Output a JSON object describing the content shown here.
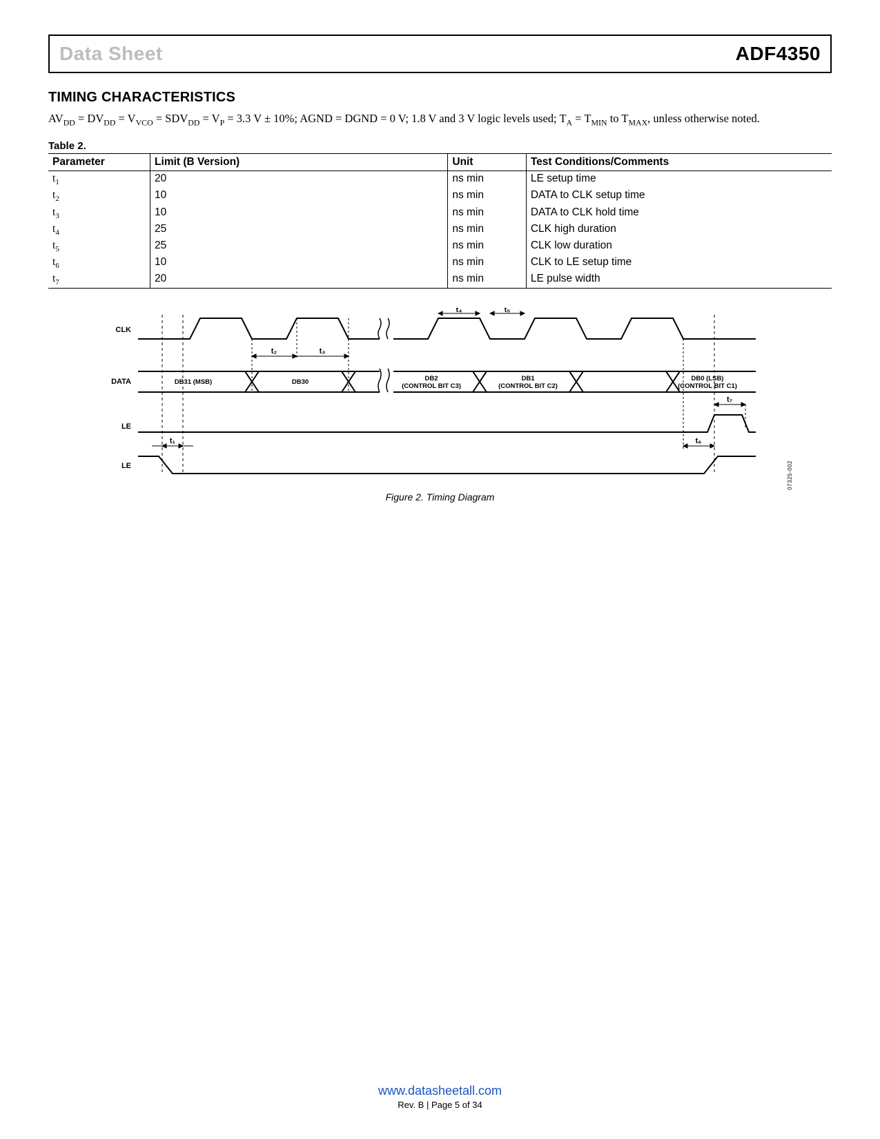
{
  "header": {
    "left": "Data Sheet",
    "right": "ADF4350"
  },
  "section": {
    "title": "TIMING CHARACTERISTICS",
    "conditions_html": "AV<sub>DD</sub> = DV<sub>DD</sub> = V<sub>VCO</sub> = SDV<sub>DD</sub> = V<sub>P</sub> = 3.3 V ± 10%; AGND = DGND = 0 V; 1.8 V and 3 V logic levels used; T<sub>A</sub> = T<sub>MIN</sub> to T<sub>MAX</sub>, unless otherwise noted."
  },
  "table": {
    "caption": "Table 2.",
    "headers": [
      "Parameter",
      "Limit (B Version)",
      "Unit",
      "Test Conditions/Comments"
    ],
    "rows": [
      {
        "param": "t",
        "sub": "1",
        "limit": "20",
        "unit": "ns min",
        "cond": "LE setup time"
      },
      {
        "param": "t",
        "sub": "2",
        "limit": "10",
        "unit": "ns min",
        "cond": "DATA to CLK setup time"
      },
      {
        "param": "t",
        "sub": "3",
        "limit": "10",
        "unit": "ns min",
        "cond": "DATA to CLK hold time"
      },
      {
        "param": "t",
        "sub": "4",
        "limit": "25",
        "unit": "ns min",
        "cond": "CLK high duration"
      },
      {
        "param": "t",
        "sub": "5",
        "limit": "25",
        "unit": "ns min",
        "cond": "CLK low duration"
      },
      {
        "param": "t",
        "sub": "6",
        "limit": "10",
        "unit": "ns min",
        "cond": "CLK to LE setup time"
      },
      {
        "param": "t",
        "sub": "7",
        "limit": "20",
        "unit": "ns min",
        "cond": "LE pulse width"
      }
    ]
  },
  "figure": {
    "caption": "Figure 2. Timing Diagram",
    "docnum": "07325-002",
    "signals": {
      "clk": "CLK",
      "data": "DATA",
      "le": "LE"
    },
    "data_bits": [
      "DB31 (MSB)",
      "DB30",
      "DB2",
      "DB1",
      "DB0 (LSB)"
    ],
    "control_bits": [
      "",
      "",
      "(CONTROL BIT C3)",
      "(CONTROL BIT C2)",
      "(CONTROL BIT C1)"
    ],
    "t_labels": {
      "t1": "t₁",
      "t2": "t₂",
      "t3": "t₃",
      "t4": "t₄",
      "t5": "t₅",
      "t6": "t₆",
      "t7": "t₇"
    }
  },
  "footer": {
    "url": "www.datasheetall.com",
    "rev": "Rev. B | Page 5 of 34"
  }
}
